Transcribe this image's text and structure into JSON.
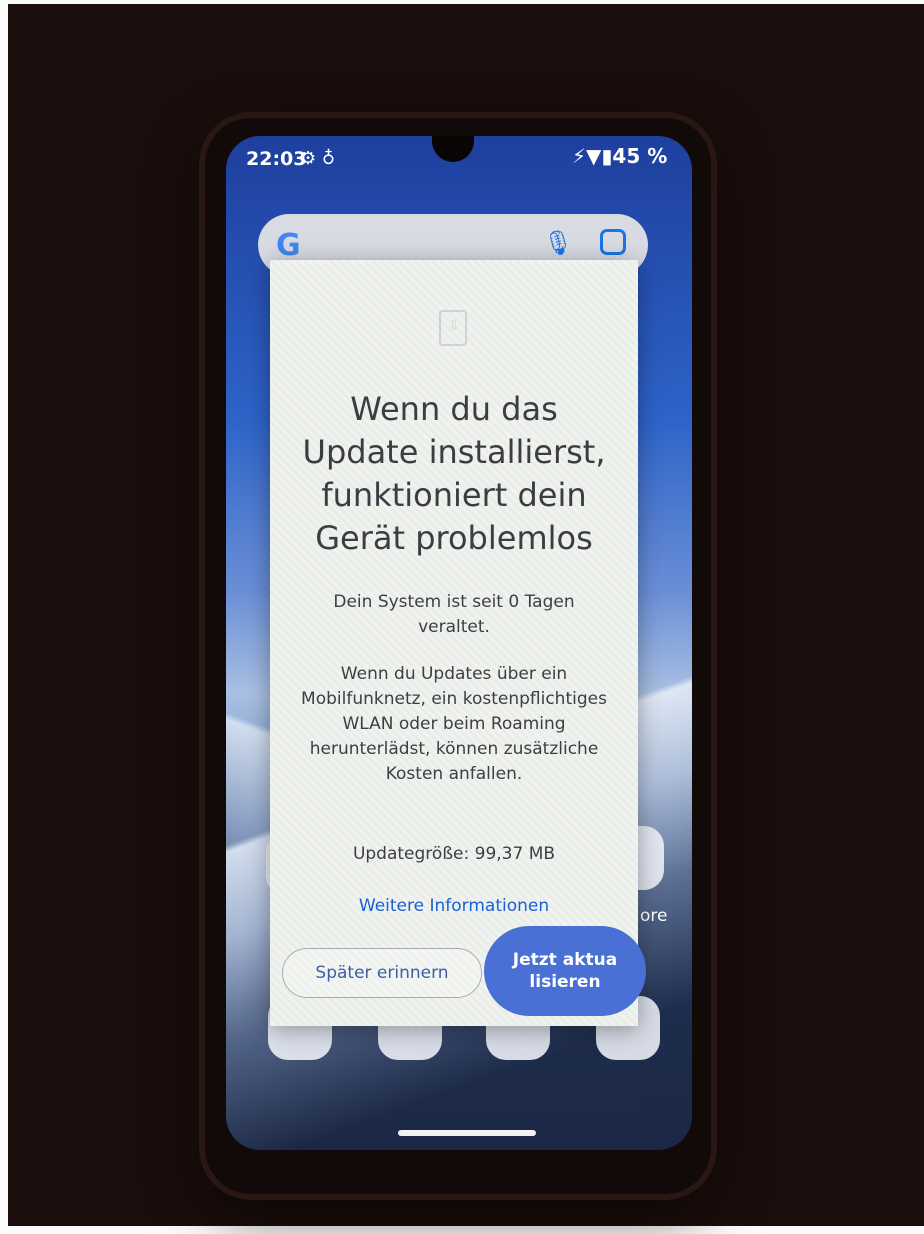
{
  "status_bar": {
    "time": "22:03",
    "left_icons": "⚙ ♁",
    "right_text": "⚡▼▮45 %"
  },
  "home": {
    "search_logo": "G",
    "partial_left_label": "G",
    "partial_right_label": "ore"
  },
  "dialog": {
    "title": "Wenn du das Update installierst, funktioniert dein Gerät problemlos",
    "body_paragraph_1": "Dein System ist seit 0 Tagen veraltet.",
    "body_paragraph_2": "Wenn du Updates über ein Mobilfunknetz, ein kostenpflichtiges WLAN oder beim Roaming herunterlädst, können zusätzliche Kosten anfallen.",
    "update_size": "Updategröße: 99,37 MB",
    "more_info_link": "Weitere Informationen",
    "later_button": "Später erinnern",
    "update_now_button": "Jetzt aktualisieren"
  },
  "colors": {
    "accent": "#4a6fd5",
    "link": "#1a5fd8"
  }
}
